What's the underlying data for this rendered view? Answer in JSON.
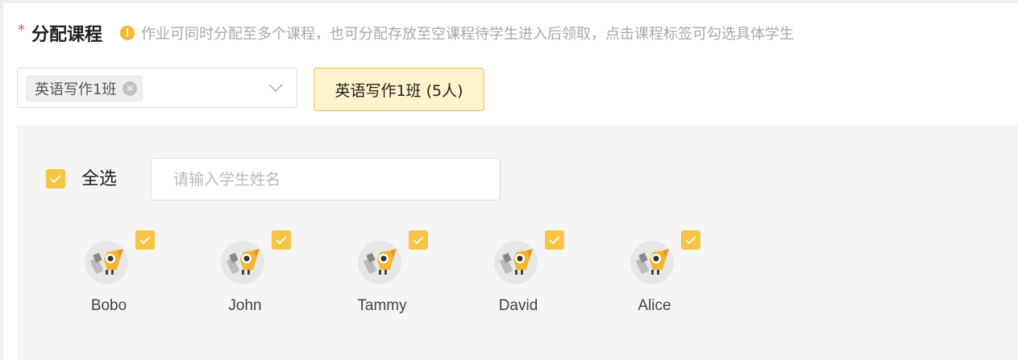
{
  "form": {
    "required_mark": "*",
    "title": "分配课程",
    "hint_icon": "info-icon",
    "hint": "作业可同时分配至多个课程，也可分配存放至空课程待学生进入后领取，点击课程标签可勾选具体学生"
  },
  "course_select": {
    "selected_tag": "英语写作1班",
    "tag_close_icon": "close-icon",
    "dropdown_icon": "chevron-down-icon"
  },
  "course_tab": {
    "label": "英语写作1班 (5人)"
  },
  "student_panel": {
    "select_all_label": "全选",
    "select_all_checked": true,
    "search_placeholder": "请输入学生姓名",
    "students": [
      {
        "name": "Bobo",
        "checked": true
      },
      {
        "name": "John",
        "checked": true
      },
      {
        "name": "Tammy",
        "checked": true
      },
      {
        "name": "David",
        "checked": true
      },
      {
        "name": "Alice",
        "checked": true
      }
    ]
  },
  "colors": {
    "accent": "#f8c544",
    "tag_bg": "#fff2cc",
    "required": "#e34d59"
  }
}
